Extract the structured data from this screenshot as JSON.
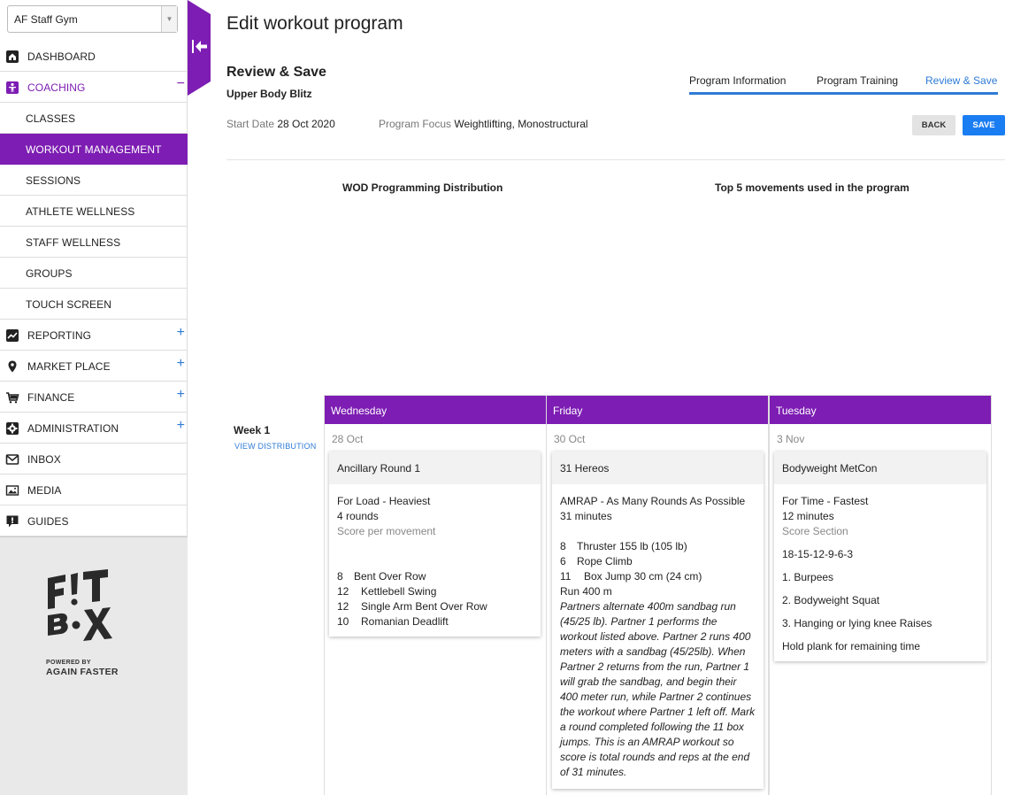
{
  "gym_select": {
    "value": "AF Staff Gym"
  },
  "nav": {
    "items": [
      {
        "label": "DASHBOARD",
        "icon": "home-icon"
      },
      {
        "label": "COACHING",
        "icon": "person-icon",
        "sign": "−"
      },
      {
        "label": "CLASSES"
      },
      {
        "label": "WORKOUT MANAGEMENT"
      },
      {
        "label": "SESSIONS"
      },
      {
        "label": "ATHLETE WELLNESS"
      },
      {
        "label": "STAFF WELLNESS"
      },
      {
        "label": "GROUPS"
      },
      {
        "label": "TOUCH SCREEN"
      },
      {
        "label": "REPORTING",
        "icon": "chart-icon",
        "sign": "+"
      },
      {
        "label": "MARKET PLACE",
        "icon": "location-pin-icon",
        "sign": "+"
      },
      {
        "label": "FINANCE",
        "icon": "cart-icon",
        "sign": "+"
      },
      {
        "label": "ADMINISTRATION",
        "icon": "gear-icon",
        "sign": "+"
      },
      {
        "label": "INBOX",
        "icon": "mail-icon"
      },
      {
        "label": "MEDIA",
        "icon": "image-icon"
      },
      {
        "label": "GUIDES",
        "icon": "info-speech-icon"
      }
    ]
  },
  "logo": {
    "powered": "POWERED BY",
    "brand": "AGAIN FASTER"
  },
  "header": {
    "page_title": "Edit workout program",
    "section_title": "Review & Save",
    "program_name": "Upper Body Blitz",
    "start_date_label": "Start Date",
    "start_date": "28 Oct 2020",
    "focus_label": "Program Focus",
    "focus": "Weightlifting, Monostructural"
  },
  "tabs": [
    "Program Information",
    "Program Training",
    "Review & Save"
  ],
  "colors": {
    "accent": "#7d1db3",
    "blue": "#2f7bd6",
    "save": "#1a7df2"
  },
  "buttons": {
    "back": "BACK",
    "save": "SAVE"
  },
  "charts": {
    "distribution_title": "WOD Programming Distribution",
    "top_movements_title": "Top 5 movements used in the program"
  },
  "week": {
    "label": "Week 1",
    "view_link": "VIEW DISTRIBUTION"
  },
  "days": [
    {
      "day": "Wednesday",
      "date": "28 Oct",
      "workout": "Ancillary Round 1",
      "scoring": "For Load - Heaviest",
      "duration": "4 rounds",
      "score_note": "Score per movement",
      "movements": [
        {
          "n": "8",
          "name": "Bent Over Row"
        },
        {
          "n": "12",
          "name": "Kettlebell Swing"
        },
        {
          "n": "12",
          "name": "Single Arm Bent Over Row"
        },
        {
          "n": "10",
          "name": "Romanian Deadlift"
        }
      ]
    },
    {
      "day": "Friday",
      "date": "30 Oct",
      "workout": "31 Hereos",
      "scoring": "AMRAP - As Many Rounds As Possible",
      "duration": "31 minutes",
      "movements": [
        {
          "n": "8",
          "name": "Thruster 155 lb (105 lb)"
        },
        {
          "n": "6",
          "name": "Rope Climb"
        },
        {
          "n": "11",
          "name": "Box Jump 30 cm (24 cm)"
        }
      ],
      "run": "Run 400 m",
      "note": "Partners alternate 400m sandbag run (45/25 lb). Partner 1 performs the workout listed above. Partner 2 runs 400 meters with a sandbag (45/25lb). When Partner 2 returns from the run, Partner 1 will grab the sandbag, and begin their 400 meter run, while Partner 2 continues the workout where Partner 1 left off. Mark a round completed following the 11 box jumps. This is an AMRAP workout so score is total rounds and reps at the end of 31 minutes."
    },
    {
      "day": "Tuesday",
      "date": "3 Nov",
      "workout": "Bodyweight MetCon",
      "scoring": "For Time - Fastest",
      "duration": "12 minutes",
      "score_note": "Score Section",
      "scheme": "18-15-12-9-6-3",
      "list": [
        "1. Burpees",
        "2. Bodyweight Squat",
        "3. Hanging or lying knee Raises"
      ],
      "finisher": "Hold plank for remaining time"
    }
  ]
}
